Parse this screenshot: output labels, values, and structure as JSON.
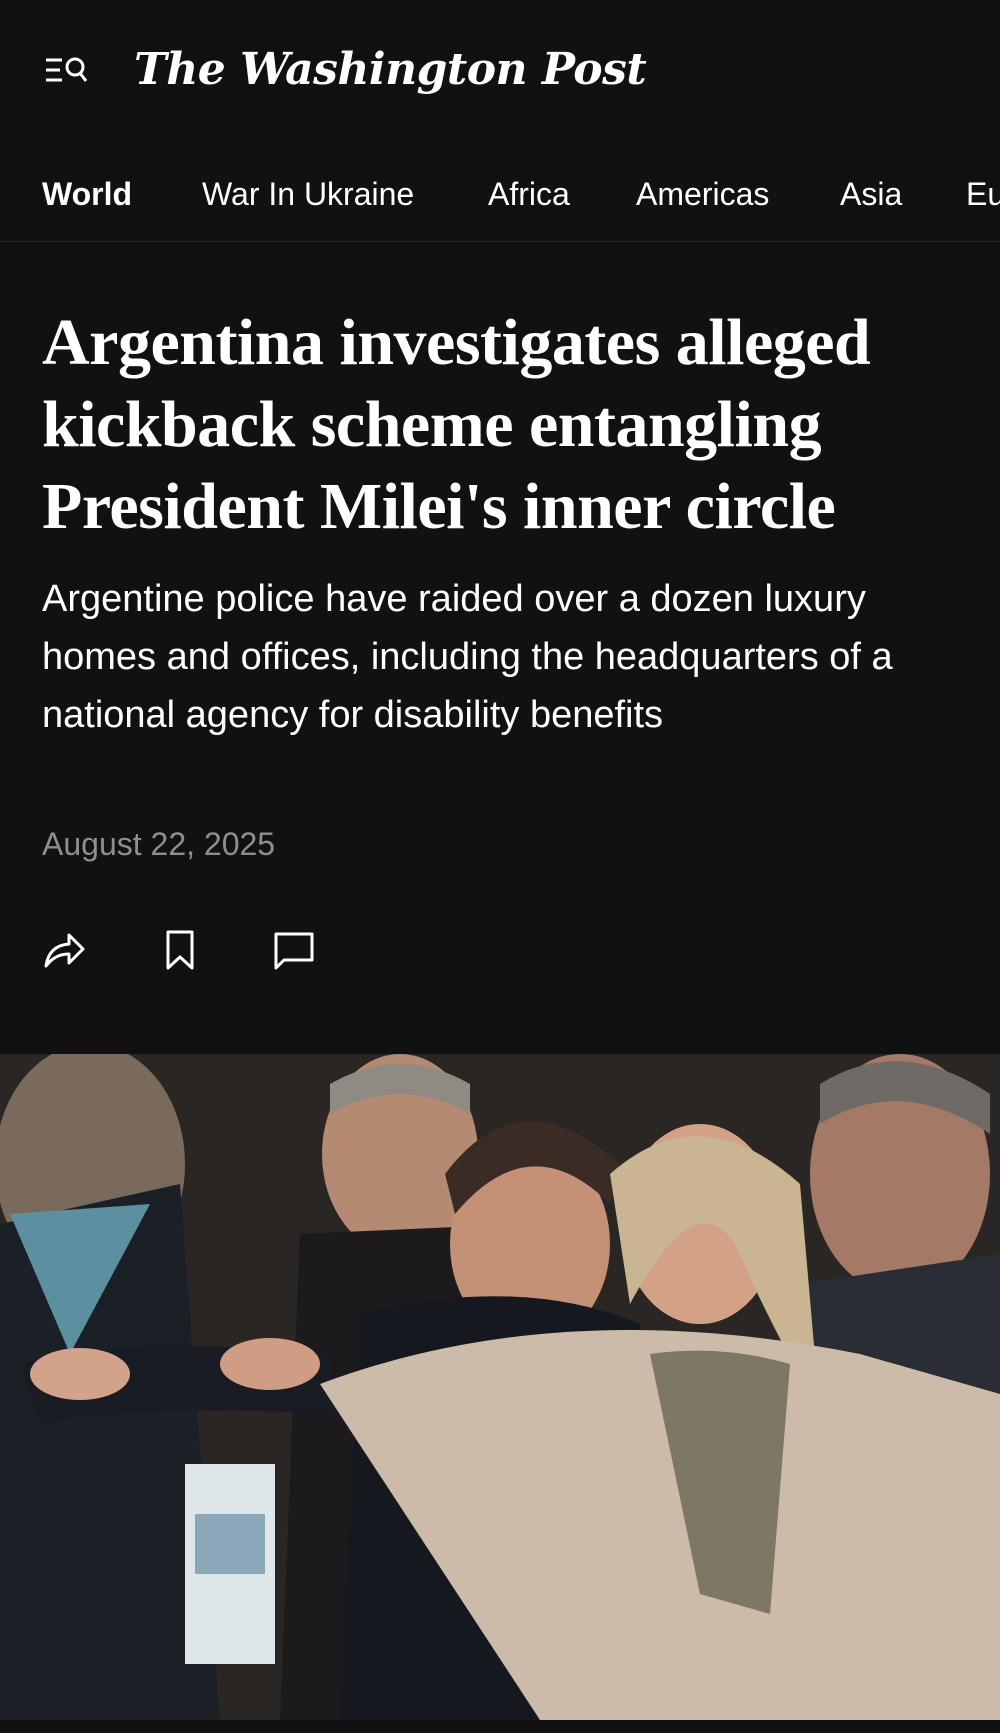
{
  "brand": {
    "name": "The Washington Post"
  },
  "nav": {
    "items": [
      {
        "label": "World",
        "active": true
      },
      {
        "label": "War In Ukraine",
        "active": false
      },
      {
        "label": "Africa",
        "active": false
      },
      {
        "label": "Americas",
        "active": false
      },
      {
        "label": "Asia",
        "active": false
      },
      {
        "label": "Eu",
        "active": false
      }
    ]
  },
  "article": {
    "headline": "Argentina investigates alleged kickback scheme entangling President Milei's inner circle",
    "dek": "Argentine police have raided over a dozen luxury homes and offices, including the headquarters of a national agency for disability benefits",
    "date": "August 22, 2025"
  },
  "icons": {
    "menu": "menu-search-icon",
    "share": "share-icon",
    "bookmark": "bookmark-icon",
    "comment": "comment-icon"
  },
  "colors": {
    "background": "#111111",
    "text": "#ffffff",
    "date": "#8e8e8e",
    "divider": "#2c2c2c"
  }
}
